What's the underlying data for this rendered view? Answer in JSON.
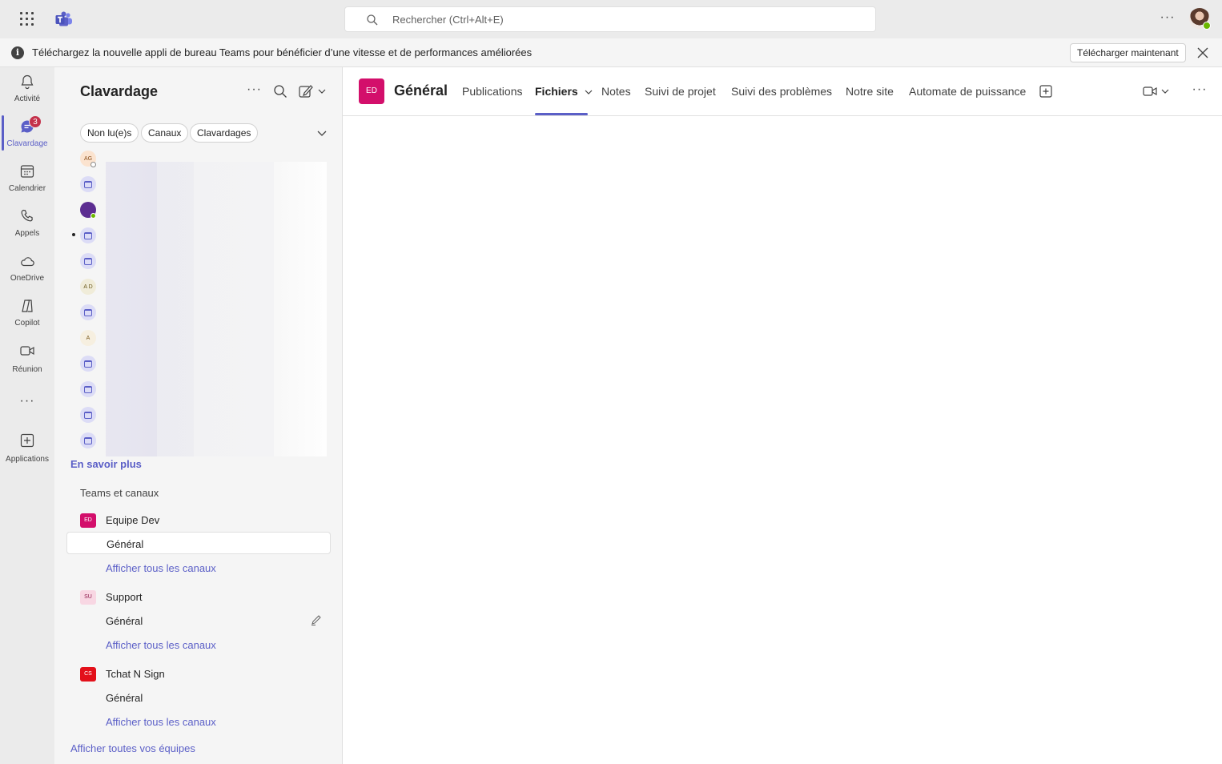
{
  "search": {
    "placeholder": "Rechercher (Ctrl+Alt+E)"
  },
  "top_bar": {
    "more_label": "···"
  },
  "banner": {
    "message": "Téléchargez la nouvelle appli de bureau Teams pour bénéficier d’une vitesse et de performances améliorées",
    "download_label": "Télécharger maintenant"
  },
  "rail": {
    "items": [
      {
        "label": "Activité",
        "icon": "bell-icon"
      },
      {
        "label": "Clavardage",
        "icon": "chat-icon",
        "badge": "3"
      },
      {
        "label": "Calendrier",
        "icon": "calendar-icon"
      },
      {
        "label": "Appels",
        "icon": "phone-icon"
      },
      {
        "label": "OneDrive",
        "icon": "cloud-icon"
      },
      {
        "label": "Copilot",
        "icon": "copilot-icon"
      },
      {
        "label": "Réunion",
        "icon": "video-icon"
      },
      {
        "label": "Applications",
        "icon": "add-apps-icon"
      }
    ],
    "more_label": "···"
  },
  "pane": {
    "title": "Clavardage",
    "more_label": "···",
    "filters": [
      "Non lu(e)s",
      "Canaux",
      "Clavardages"
    ],
    "chat_avatars": [
      "AG",
      "",
      "",
      "",
      "",
      "A D",
      "",
      "A",
      "",
      "",
      "",
      ""
    ],
    "learn_more": "En savoir plus",
    "teams_section": "Teams et canaux",
    "teams": [
      {
        "initials": "ED",
        "name": "Equipe Dev",
        "channel": "Général",
        "see_all": "Afficher tous les canaux",
        "color": "#d30f6b",
        "text_color": "#ffffff"
      },
      {
        "initials": "SU",
        "name": "Support",
        "channel": "Général",
        "see_all": "Afficher tous les canaux",
        "color": "#f8d7e3",
        "text_color": "#8f1d4f"
      },
      {
        "initials": "CS",
        "name": "Tchat N Sign",
        "channel": "Général",
        "see_all": "Afficher tous les canaux",
        "color": "#e3101a",
        "text_color": "#ffffff"
      }
    ],
    "all_teams": "Afficher toutes vos équipes"
  },
  "main": {
    "channel_initials": "ED",
    "channel_title": "Général",
    "tabs": [
      "Publications",
      "Fichiers",
      "Notes",
      "Suivi de projet",
      "Suivi des problèmes",
      "Notre site",
      "Automate de puissance"
    ],
    "active_tab": "Fichiers",
    "more_label": "···"
  },
  "colors": {
    "accent": "#5b5fc7",
    "badge": "#c4314b",
    "presence": "#6bb700"
  }
}
